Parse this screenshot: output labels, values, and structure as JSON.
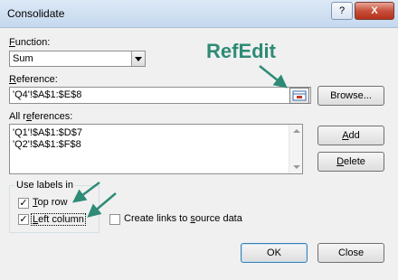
{
  "window": {
    "title": "Consolidate",
    "help_label": "?",
    "close_label": "X"
  },
  "function": {
    "label": "Function:",
    "value": "Sum"
  },
  "reference": {
    "label": "Reference:",
    "value": "'Q4'!$A$1:$E$8",
    "browse_label": "Browse..."
  },
  "all_references": {
    "label": "All references:",
    "items": [
      "'Q1'!$A$1:$D$7",
      "'Q2'!$A$1:$F$8"
    ]
  },
  "buttons": {
    "add": "Add",
    "delete": "Delete",
    "ok": "OK",
    "close": "Close"
  },
  "use_labels": {
    "group_label": "Use labels in",
    "top_row": {
      "label": "Top row",
      "checked": true
    },
    "left_column": {
      "label": "Left column",
      "checked": true
    }
  },
  "create_links": {
    "label": "Create links to source data",
    "checked": false
  },
  "annotation": {
    "text": "RefEdit",
    "color": "#2e8b76"
  }
}
